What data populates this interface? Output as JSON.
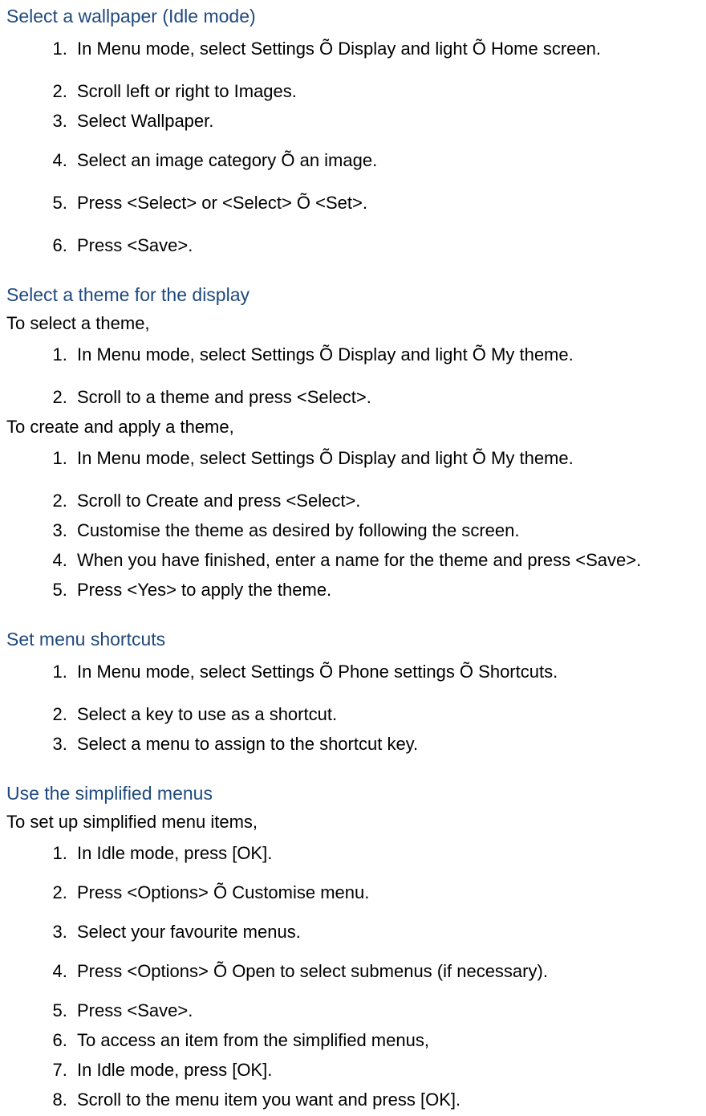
{
  "section1": {
    "heading": "Select a wallpaper (Idle mode)",
    "steps": [
      "In Menu mode, select Settings Õ Display and light Õ Home screen.",
      "Scroll left or right to Images.",
      "Select Wallpaper.",
      "Select an image category Õ an image.",
      "Press <Select> or <Select> Õ <Set>.",
      "Press <Save>."
    ]
  },
  "section2": {
    "heading": "Select a theme for the display",
    "intro1": "To select a theme,",
    "steps1": [
      "In Menu mode, select Settings Õ Display and light Õ My theme.",
      "Scroll to a theme and press <Select>."
    ],
    "intro2": "To create and apply a theme,",
    "steps2": [
      "In Menu mode, select Settings Õ Display and light Õ My theme.",
      "Scroll to Create and press <Select>.",
      "Customise the theme as desired by following the screen.",
      "When you have finished, enter a name for the theme and press <Save>.",
      "Press <Yes> to apply the theme."
    ]
  },
  "section3": {
    "heading": "Set menu shortcuts",
    "steps": [
      "In Menu mode, select Settings Õ Phone settings Õ Shortcuts.",
      "Select a key to use as a shortcut.",
      "Select a menu to assign to the shortcut key."
    ]
  },
  "section4": {
    "heading": "Use the simplified menus",
    "intro": "To set up simplified menu items,",
    "steps": [
      "In Idle mode, press [OK].",
      "Press <Options> Õ Customise menu.",
      "Select your favourite menus.",
      "Press <Options> Õ Open to select submenus (if necessary).",
      "Press <Save>.",
      "To access an item from the simplified menus,",
      "In Idle mode, press [OK].",
      "Scroll to the menu item you want and press [OK]."
    ]
  }
}
